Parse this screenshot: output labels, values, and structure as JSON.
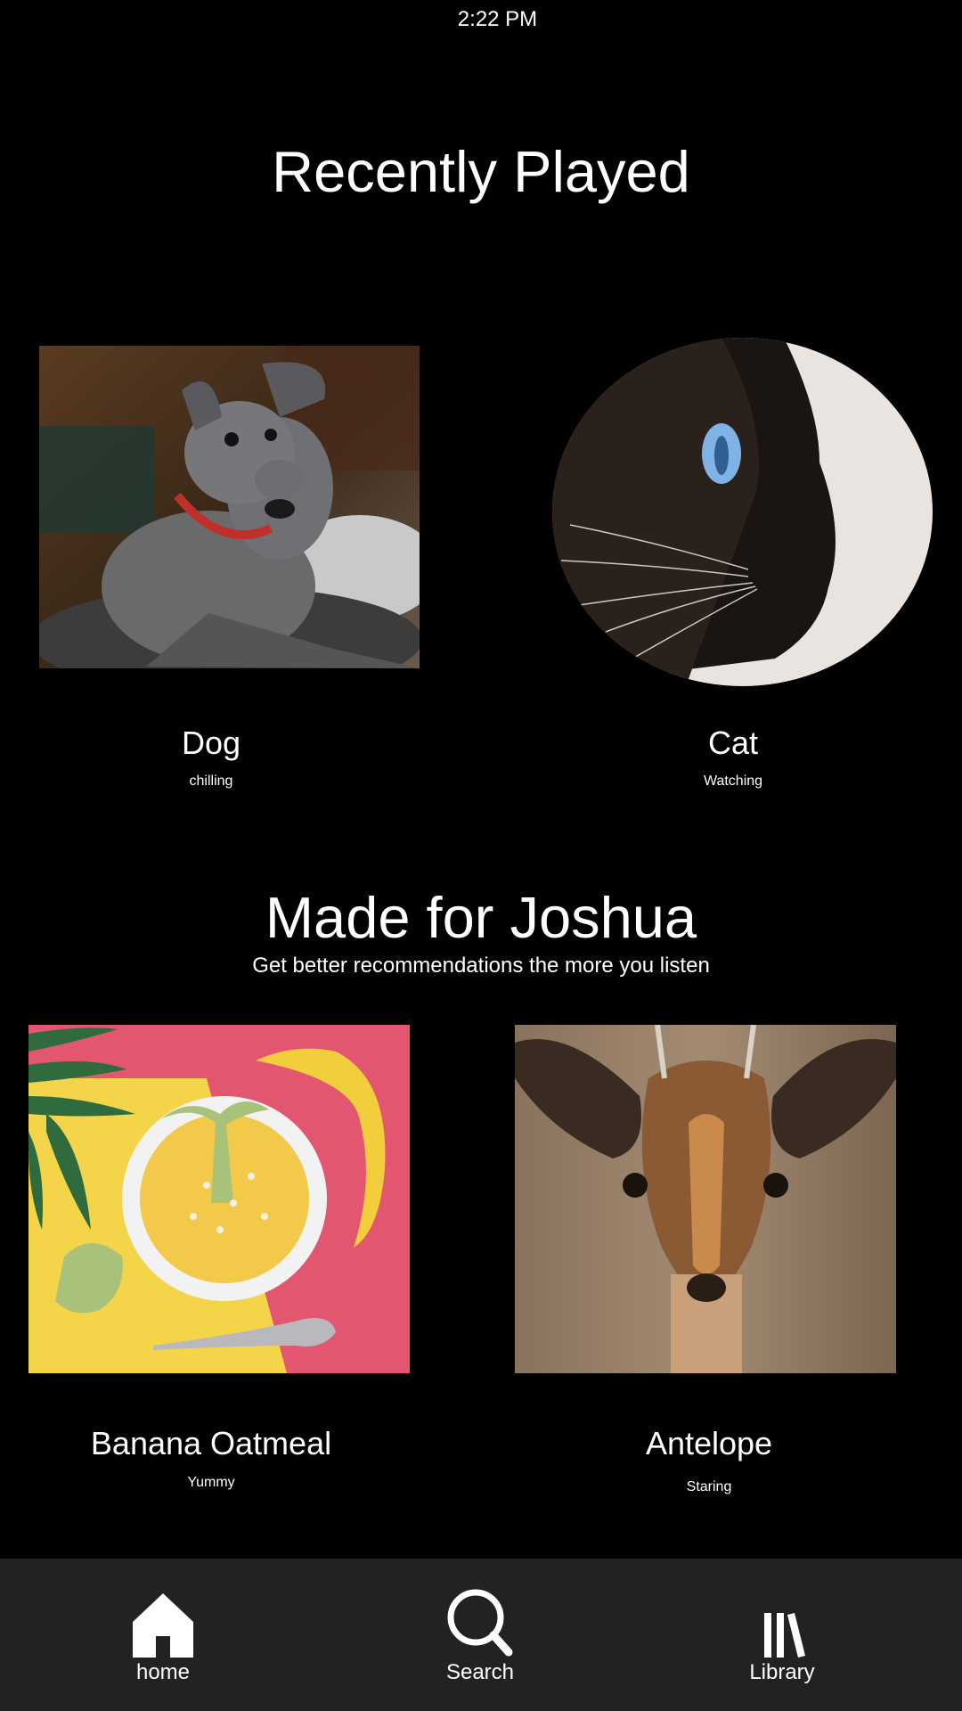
{
  "status_bar": {
    "time": "2:22 PM"
  },
  "recently_played": {
    "title": "Recently Played",
    "items": [
      {
        "title": "Dog",
        "subtitle": "chilling",
        "image": "dog-photo"
      },
      {
        "title": "Cat",
        "subtitle": "Watching",
        "image": "cat-photo"
      }
    ]
  },
  "made_for": {
    "title": "Made for Joshua",
    "subtitle": "Get better recommendations the more you listen",
    "items": [
      {
        "title": "Banana Oatmeal",
        "subtitle": "Yummy",
        "image": "banana-oatmeal-photo"
      },
      {
        "title": "Antelope",
        "subtitle": "Staring",
        "image": "antelope-photo"
      }
    ]
  },
  "tab_bar": {
    "tabs": [
      {
        "label": "home",
        "icon": "home-icon"
      },
      {
        "label": "Search",
        "icon": "search-icon"
      },
      {
        "label": "Library",
        "icon": "library-icon"
      }
    ]
  },
  "colors": {
    "background": "#000000",
    "tab_bar": "#222222",
    "text": "#ffffff"
  }
}
